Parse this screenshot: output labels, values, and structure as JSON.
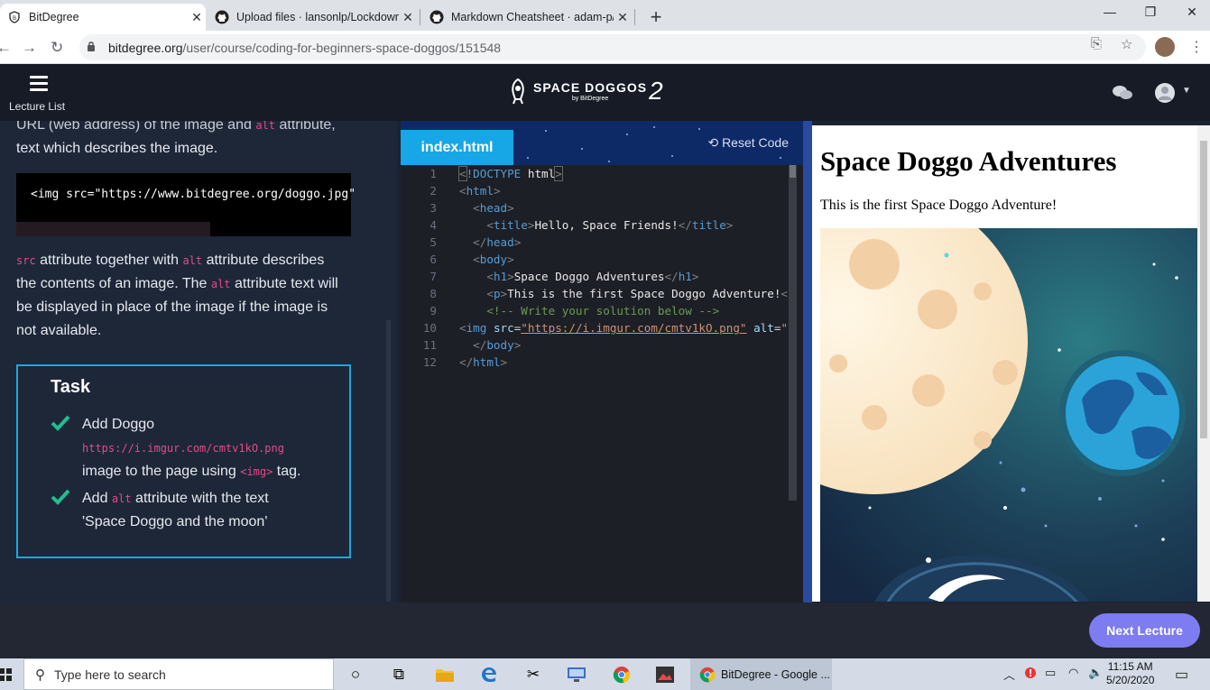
{
  "browser": {
    "tabs": [
      {
        "title": "BitDegree",
        "icon": "bitdegree-icon",
        "active": true
      },
      {
        "title": "Upload files · lansonlp/Lockdown",
        "icon": "github-icon",
        "active": false
      },
      {
        "title": "Markdown Cheatsheet · adam-p/",
        "icon": "github-icon",
        "active": false
      }
    ],
    "url_domain": "bitdegree.org",
    "url_path": "/user/course/coding-for-beginners-space-doggos/151548"
  },
  "header": {
    "menu_label": "Lecture List",
    "logo_text": "SPACE DOGGOS",
    "logo_sub": "by BitDegree",
    "logo_number": "2"
  },
  "lesson": {
    "partial_top": "URL (web address) of the image and",
    "partial_code": "alt",
    "partial_top_end": "attribute,",
    "intro_line": "text which describes the image.",
    "code_example": "<img src=\"https://www.bitdegree.org/doggo.jpg\"",
    "p_code1": "src",
    "p_text1": " attribute together with ",
    "p_code2": "alt",
    "p_text2": " attribute describes the contents of an image. The ",
    "p_code3": "alt",
    "p_text3": " attribute text will be displayed in place of the image if the image is not available."
  },
  "task": {
    "title": "Task",
    "item1_pre": "Add Doggo",
    "item1_link": "https://i.imgur.com/cmtv1kO.png",
    "item1_post_a": "image to the page using ",
    "item1_code": "<img>",
    "item1_post_b": " tag.",
    "item2_pre": "Add ",
    "item2_code": "alt",
    "item2_post": " attribute with the text",
    "item2_text": "'Space Doggo and the moon'"
  },
  "editor": {
    "file_tab": "index.html",
    "reset_label": "Reset Code",
    "line_numbers": [
      "1",
      "2",
      "3",
      "4",
      "5",
      "6",
      "7",
      "8",
      "9",
      "10",
      "11",
      "12"
    ]
  },
  "preview": {
    "heading": "Space Doggo Adventures",
    "paragraph": "This is the first Space Doggo Adventure!"
  },
  "footer": {
    "next_label": "Next Lecture"
  },
  "taskbar": {
    "search_placeholder": "Type here to search",
    "active_app": "BitDegree - Google ...",
    "time": "11:15 AM",
    "date": "5/20/2020"
  },
  "colors": {
    "accent_blue": "#17a7e6",
    "next_button": "#7d7cf0",
    "code_pink": "#e24b8a",
    "check_green": "#1fbf8f"
  }
}
